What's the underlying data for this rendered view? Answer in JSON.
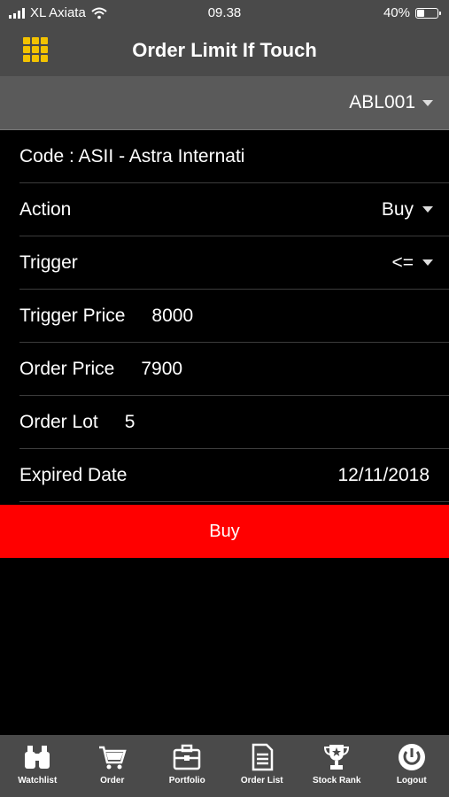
{
  "status_bar": {
    "carrier": "XL Axiata",
    "time": "09.38",
    "battery": "40%",
    "battery_level": 0.4
  },
  "header": {
    "title": "Order Limit If Touch"
  },
  "account": {
    "selected": "ABL001"
  },
  "form": {
    "code": "Code : ASII - Astra Internati",
    "action_label": "Action",
    "action_value": "Buy",
    "trigger_label": "Trigger",
    "trigger_value": "<=",
    "trigger_price_label": "Trigger Price",
    "trigger_price_value": "8000",
    "order_price_label": "Order Price",
    "order_price_value": "7900",
    "order_lot_label": "Order Lot",
    "order_lot_value": "5",
    "expired_date_label": "Expired Date",
    "expired_date_value": "12/11/2018"
  },
  "submit": {
    "label": "Buy",
    "color": "#ff0000"
  },
  "accent": "#f2c200",
  "tabs": [
    {
      "label": "Watchlist",
      "icon": "binoculars-icon"
    },
    {
      "label": "Order",
      "icon": "cart-icon"
    },
    {
      "label": "Portfolio",
      "icon": "briefcase-icon"
    },
    {
      "label": "Order List",
      "icon": "document-icon"
    },
    {
      "label": "Stock Rank",
      "icon": "trophy-icon"
    },
    {
      "label": "Logout",
      "icon": "power-icon"
    }
  ]
}
